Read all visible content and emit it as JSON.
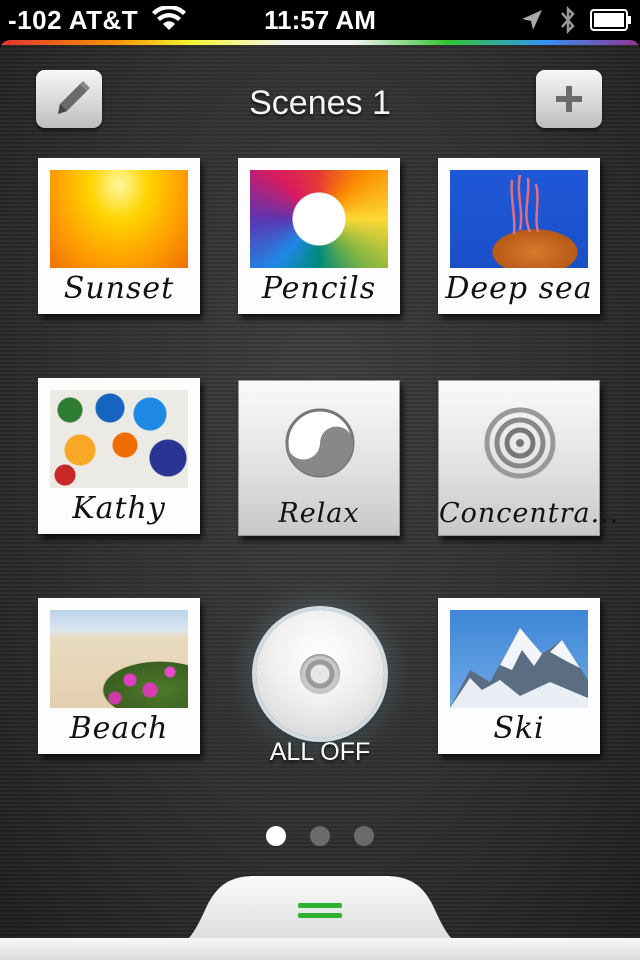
{
  "status_bar": {
    "carrier": "-102 AT&T",
    "time": "11:57 AM",
    "icons": [
      "wifi-icon",
      "location-icon",
      "bluetooth-icon",
      "battery-icon"
    ]
  },
  "header": {
    "title": "Scenes 1",
    "edit_icon": "pencil-icon",
    "add_icon": "plus-icon"
  },
  "scenes": [
    {
      "label": "Sunset"
    },
    {
      "label": "Pencils"
    },
    {
      "label": "Deep sea"
    },
    {
      "label": "Kathy"
    },
    {
      "label": "Relax"
    },
    {
      "label": "Concentra..."
    },
    {
      "label": "Beach"
    },
    {
      "label": "Ski"
    }
  ],
  "all_off": {
    "label": "ALL OFF"
  },
  "pager": {
    "pages": 3,
    "current": 1
  },
  "colors": {
    "accent_green": "#2fb22f",
    "rainbow_strip": [
      "#e33",
      "#f90",
      "#ff3",
      "#fff",
      "#3c3",
      "#39f",
      "#939"
    ]
  }
}
